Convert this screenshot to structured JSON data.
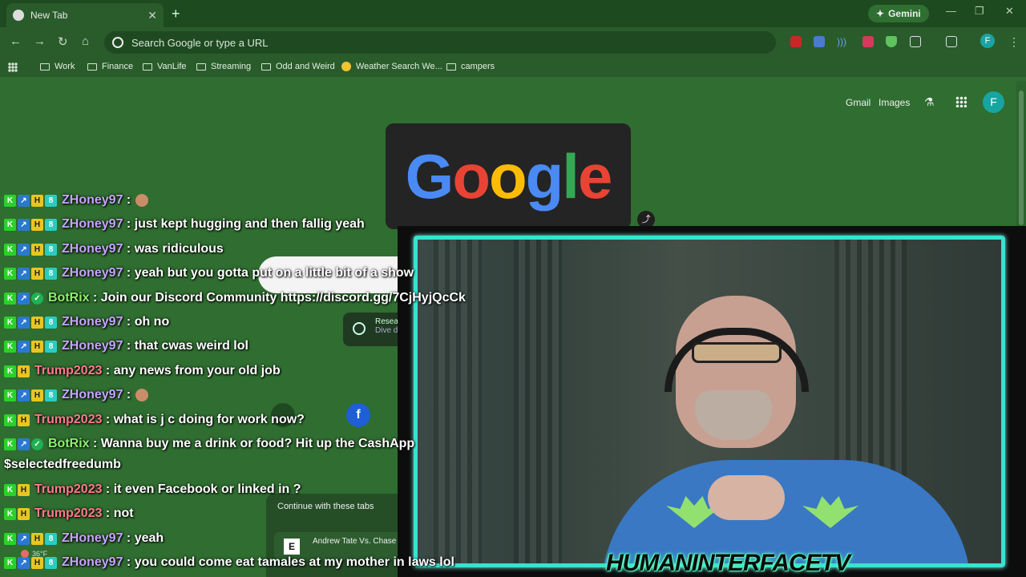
{
  "tab": {
    "title": "New Tab"
  },
  "gemini": {
    "label": "Gemini"
  },
  "omnibox": {
    "placeholder": "Search Google or type a URL"
  },
  "profile": {
    "initial": "F"
  },
  "bookmarks": [
    "Work",
    "Finance",
    "VanLife",
    "Streaming",
    "Odd and Weird",
    "Weather Search We...",
    "campers"
  ],
  "ntp": {
    "links": [
      "Gmail",
      "Images"
    ],
    "avatar_initial": "F",
    "doodle_text": "Google",
    "continue_header": "Continue with these tabs",
    "continue_item": "Andrew Tate Vs. Chase",
    "continue_favicon": "E",
    "research_label": "Resea",
    "research_sub": "Dive d"
  },
  "chat": [
    {
      "user": "ZHoney97",
      "type": "zh",
      "text": ": ",
      "emote": true
    },
    {
      "user": "ZHoney97",
      "type": "zh",
      "text": ": just kept hugging and then fallig yeah"
    },
    {
      "user": "ZHoney97",
      "type": "zh",
      "text": ": was ridiculous"
    },
    {
      "user": "ZHoney97",
      "type": "zh",
      "text": ": yeah but you gotta put on a little bit of a show"
    },
    {
      "user": "BotRix",
      "type": "bot",
      "text": ": Join our Discord Community https://discord.gg/7CjHyjQcCk"
    },
    {
      "user": "ZHoney97",
      "type": "zh",
      "text": ": oh no"
    },
    {
      "user": "ZHoney97",
      "type": "zh",
      "text": ": that cwas weird lol"
    },
    {
      "user": "Trump2023",
      "type": "tr",
      "text": ": any news from your old job"
    },
    {
      "user": "ZHoney97",
      "type": "zh",
      "text": ": ",
      "emote": true
    },
    {
      "user": "Trump2023",
      "type": "tr",
      "text": ": what is j c doing for work now?"
    },
    {
      "user": "BotRix",
      "type": "bot",
      "text": ": Wanna buy me a drink or food? Hit up the CashApp"
    },
    {
      "user": "",
      "type": "cont",
      "text": "$selectedfreedumb"
    },
    {
      "user": "Trump2023",
      "type": "tr",
      "text": ": it even Facebook or linked in ?"
    },
    {
      "user": "Trump2023",
      "type": "tr",
      "text": ": not"
    },
    {
      "user": "ZHoney97",
      "type": "zh",
      "text": ": yeah"
    },
    {
      "user": "ZHoney97",
      "type": "zh",
      "text": ": you could come eat tamales at my mother in laws lol"
    }
  ],
  "weather": {
    "temp": "36°F"
  },
  "watermark": "HUMANINTERFACETV",
  "colors": {
    "page_bg": "#2f6d30",
    "cam_border": "#36e3d0",
    "zh_name": "#c6a4ff",
    "trump_name": "#ff7b8b",
    "bot_name": "#8cf06b"
  }
}
